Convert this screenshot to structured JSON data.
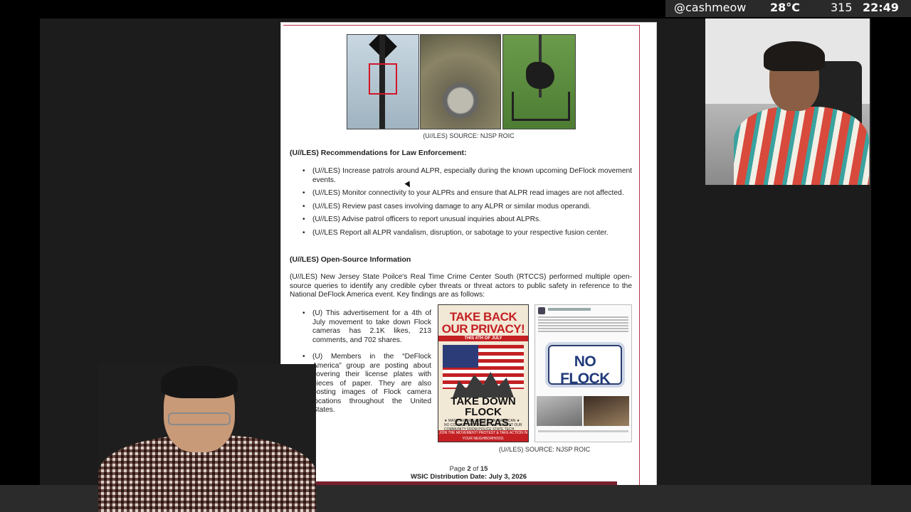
{
  "overlay": {
    "handle": "@cashmeow",
    "temperature": "28°C",
    "counter": "315",
    "clock": "22:49"
  },
  "document": {
    "figure_caption_top": "(U//LES) SOURCE: NJSP ROIC",
    "recommendations_heading": "(U//LES) Recommendations for Law Enforcement:",
    "recommendations": [
      "(U//LES) Increase patrols around ALPR, especially during the known upcoming DeFlock movement events.",
      "(U//LES) Monitor connectivity to your ALPRs and ensure that ALPR read images are not affected.",
      "(U//LES) Review past cases involving damage to any ALPR or similar modus operandi.",
      "(U//LES) Advise patrol officers to report unusual inquiries about ALPRs.",
      "(U//LES Report all ALPR vandalism, disruption, or sabotage to your respective fusion center."
    ],
    "osint_heading": "(U//LES) Open-Source Information",
    "osint_paragraph": "(U//LES) New Jersey State Poilce's Real Time Crime Center South (RTCCS) performed multiple open-source queries to identify any credible cyber threats or threat actors to public safety in reference to the National DeFlock America event. Key findings are as follows:",
    "findings": [
      "(U) This advertisement for a 4th of July movement to take down Flock cameras has 2.1K likes, 213 comments, and 702 shares.",
      "(U) Members in the “DeFlock America” group are posting about covering their license plates with pieces of paper. They are also posting images of Flock camera locations throughout the United States."
    ],
    "poster": {
      "top_text": "TAKE BACK OUR PRIVACY!",
      "date_text": "THIS 4TH OF JULY",
      "bottom_text": "TAKE DOWN FLOCK CAMERAS.",
      "bullets": "★ MASS SURVEILLANCE = UN-AMERICAN ★ NO CONSENT, NO PRIVACY ★ PROTECT OUR COMMUNITY FROM POLICE STATE TECH.",
      "banner": "JOIN THE MOVEMENT! PROTEST & TAKE ACTION IN YOUR NEIGHBORHOOD."
    },
    "post_plate_text": "NO FLOCK",
    "figure_caption_bottom": "(U//LES) SOURCE: NJSP ROIC",
    "page_label_prefix": "Page",
    "page_current": "2",
    "page_of": "of",
    "page_total": "15",
    "distribution": "WSIC Distribution Date: July 3, 2026"
  }
}
